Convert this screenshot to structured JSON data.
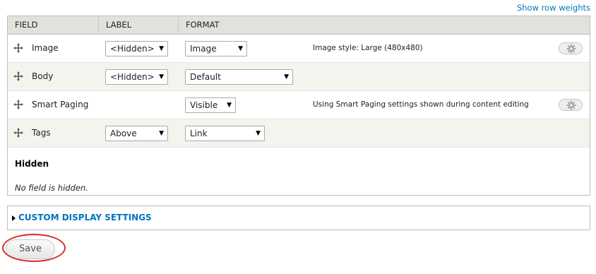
{
  "top_link": "Show row weights",
  "table": {
    "headers": [
      "FIELD",
      "LABEL",
      "FORMAT"
    ],
    "rows": [
      {
        "field": "Image",
        "label": "<Hidden>",
        "format": "Image",
        "summary": "Image style: Large (480x480)",
        "has_settings": true
      },
      {
        "field": "Body",
        "label": "<Hidden>",
        "format": "Default",
        "summary": "",
        "has_settings": false
      },
      {
        "field": "Smart Paging",
        "label": "",
        "format": "Visible",
        "summary": "Using Smart Paging settings shown during content editing",
        "has_settings": true
      },
      {
        "field": "Tags",
        "label": "Above",
        "format": "Link",
        "summary": "",
        "has_settings": false
      }
    ],
    "hidden_region": {
      "title": "Hidden",
      "empty_text": "No field is hidden."
    }
  },
  "custom_display": {
    "title": "CUSTOM DISPLAY SETTINGS"
  },
  "save_label": "Save",
  "colors": {
    "link": "#0074bd",
    "header_bg": "#e1e2dc",
    "even_row_bg": "#f3f4ee",
    "highlight": "#d62b2b"
  }
}
